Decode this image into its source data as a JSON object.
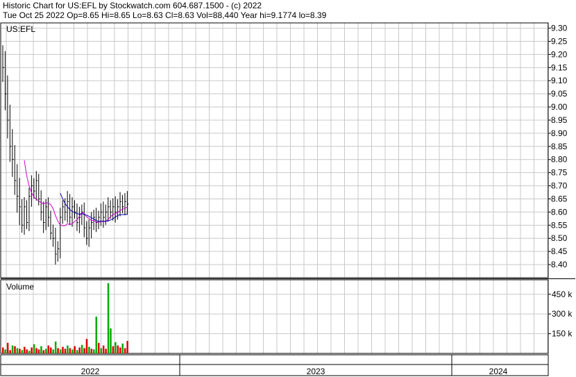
{
  "header": {
    "line1": "Historic Chart for US:EFL by Stockwatch.com 604.687.1500 - (c) 2022",
    "line2": "Tue Oct 25 2022  Op=8.65  Hi=8.65  Lo=8.63  Cl=8.63  Vol=88,440  Year hi=9.1774  lo=8.39"
  },
  "chart_data": {
    "type": "bar",
    "symbol": "US:EFL",
    "price_panel": {
      "ylim": [
        8.35,
        9.32
      ],
      "yticks": [
        "9.30",
        "9.25",
        "9.20",
        "9.15",
        "9.10",
        "9.05",
        "9.00",
        "8.95",
        "8.90",
        "8.85",
        "8.80",
        "8.75",
        "8.70",
        "8.65",
        "8.60",
        "8.55",
        "8.50",
        "8.45",
        "8.40"
      ],
      "close_levels": [
        9.15,
        9.05,
        8.95,
        8.85,
        8.8,
        8.72,
        8.66,
        8.62,
        8.55,
        8.62,
        8.56,
        8.66,
        8.7,
        8.68,
        8.72,
        8.65,
        8.6,
        8.56,
        8.62,
        8.58,
        8.52,
        8.5,
        8.44,
        8.46,
        8.58,
        8.62,
        8.6,
        8.64,
        8.58,
        8.62,
        8.6,
        8.56,
        8.58,
        8.6,
        8.54,
        8.5,
        8.54,
        8.56,
        8.58,
        8.56,
        8.58,
        8.6,
        8.58,
        8.6,
        8.62,
        8.6,
        8.62,
        8.6,
        8.62,
        8.64,
        8.62,
        8.64,
        8.63
      ],
      "ma_colors": [
        "#cc00cc",
        "#0000aa"
      ],
      "grid": true
    },
    "volume_panel": {
      "title": "Volume",
      "ylim": [
        0,
        560
      ],
      "ytick_values": [
        150,
        300,
        450
      ],
      "yticks": [
        "150 k",
        "300 k",
        "450 k"
      ],
      "units": "thousands",
      "up_color": "#00aa00",
      "down_color": "#dd0000",
      "values": [
        45,
        30,
        80,
        25,
        60,
        55,
        40,
        35,
        25,
        50,
        30,
        20,
        45,
        70,
        40,
        30,
        55,
        25,
        35,
        60,
        45,
        30,
        90,
        40,
        30,
        50,
        35,
        60,
        40,
        30,
        55,
        25,
        45,
        65,
        40,
        110,
        50,
        35,
        30,
        280,
        80,
        40,
        60,
        35,
        535,
        190,
        55,
        85,
        60,
        45,
        75,
        40,
        95
      ],
      "colors": [
        "r",
        "g",
        "r",
        "r",
        "g",
        "r",
        "g",
        "r",
        "g",
        "r",
        "r",
        "g",
        "r",
        "g",
        "r",
        "r",
        "g",
        "r",
        "g",
        "r",
        "r",
        "g",
        "g",
        "r",
        "g",
        "r",
        "r",
        "g",
        "r",
        "g",
        "r",
        "g",
        "r",
        "g",
        "r",
        "r",
        "g",
        "r",
        "g",
        "g",
        "r",
        "g",
        "r",
        "r",
        "g",
        "g",
        "r",
        "g",
        "r",
        "r",
        "g",
        "r",
        "r"
      ]
    },
    "x_labels": [
      "2022",
      "2023",
      "2024"
    ]
  }
}
